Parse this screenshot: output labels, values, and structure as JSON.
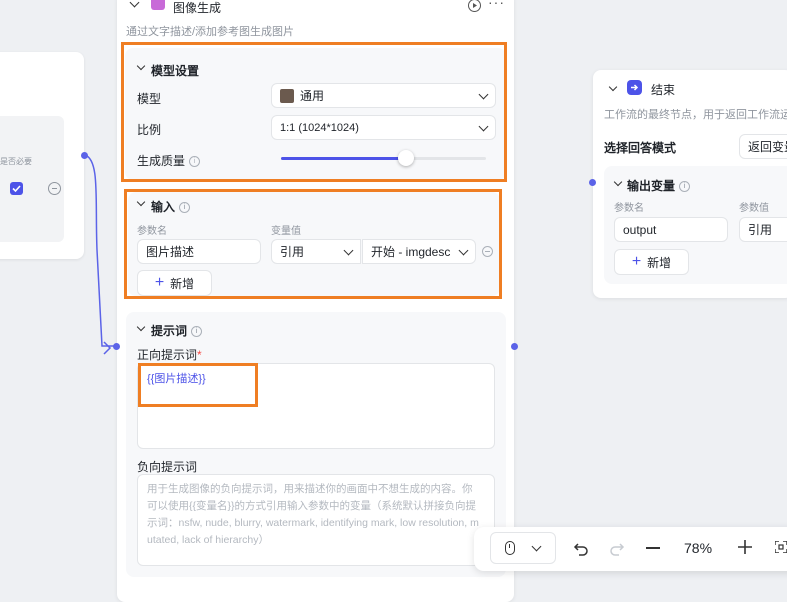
{
  "left_node": {
    "required_label": "是否必要"
  },
  "image_node": {
    "title": "图像生成",
    "description": "通过文字描述/添加参考图生成图片",
    "model_settings": {
      "heading": "模型设置",
      "model_label": "模型",
      "model_value": "通用",
      "ratio_label": "比例",
      "ratio_value": "1:1 (1024*1024)",
      "quality_label": "生成质量",
      "quality_level_percent": 64
    },
    "input": {
      "heading": "输入",
      "param_name_header": "参数名",
      "var_value_header": "变量值",
      "param_name": "图片描述",
      "ref_type": "引用",
      "ref_value": "开始 - imgdesc",
      "add_label": "新增"
    },
    "prompt": {
      "heading": "提示词",
      "positive_label": "正向提示词",
      "required_mark": "*",
      "positive_value": "{{图片描述}}",
      "negative_label": "负向提示词",
      "negative_placeholder": "用于生成图像的负向提示词，用来描述你的画面中不想生成的内容。你可以使用{{变量名}}的方式引用输入参数中的变量（系统默认拼接负向提示词：nsfw, nude, blurry, watermark, identifying mark, low resolution, mutated, lack of hierarchy）"
    }
  },
  "end_node": {
    "title": "结束",
    "description": "工作流的最终节点，用于返回工作流运",
    "answer_mode_label": "选择回答模式",
    "answer_mode_value": "返回变量",
    "output_heading": "输出变量",
    "param_name_header": "参数名",
    "param_value_header": "参数值",
    "output_name": "output",
    "output_ref": "引用",
    "add_label": "新增"
  },
  "toolbar": {
    "zoom": "78%"
  },
  "colors": {
    "accent": "#4d53e8",
    "highlight_border": "#ef7e23",
    "connector": "#5b63e8",
    "image_node_icon": "#c86ad8"
  }
}
